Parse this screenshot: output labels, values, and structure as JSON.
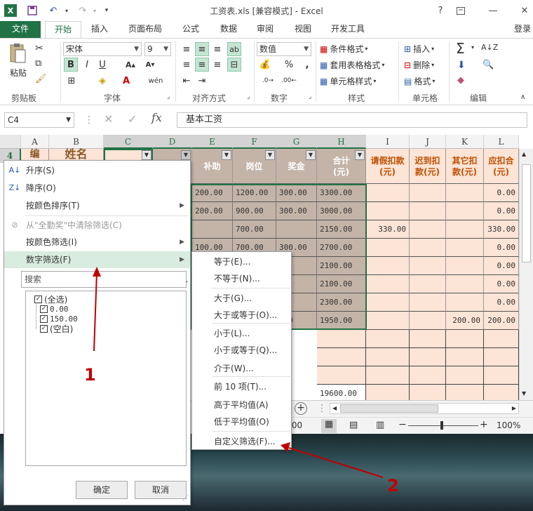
{
  "app": {
    "title": "工资表.xls  [兼容模式] - Excel",
    "account": "登录"
  },
  "quick_access": {
    "excel_logo": "X",
    "help": "?",
    "minimize": "—",
    "close": "✕"
  },
  "ribbon_tabs": [
    "文件",
    "开始",
    "插入",
    "页面布局",
    "公式",
    "数据",
    "审阅",
    "视图",
    "开发工具"
  ],
  "ribbon": {
    "clipboard": {
      "paste": "粘贴",
      "label": "剪贴板"
    },
    "font": {
      "name": "宋体",
      "size": "9",
      "bold": "B",
      "italic": "I",
      "underline": "U",
      "wen": "wén",
      "label": "字体"
    },
    "align": {
      "label": "对齐方式"
    },
    "number": {
      "format": "数值",
      "label": "数字",
      "pct": "%",
      "comma": ","
    },
    "styles": {
      "cond": "条件格式",
      "table": "套用表格格式",
      "cell": "单元格样式",
      "label": "样式"
    },
    "cells": {
      "insert": "插入",
      "delete": "删除",
      "format": "格式",
      "label": "单元格"
    },
    "edit": {
      "label": "编辑"
    }
  },
  "formula_bar": {
    "name_box": "C4",
    "formula": "基本工资",
    "fx": "fx"
  },
  "grid": {
    "columns": [
      "A",
      "B",
      "C",
      "D",
      "E",
      "F",
      "G",
      "H",
      "I",
      "J",
      "K",
      "L"
    ],
    "row_number": "4",
    "header_cells": {
      "A": "编",
      "B": "姓名",
      "E": "补助",
      "F": "岗位",
      "G": "奖金",
      "H": "合计\n(元)",
      "I": "请假扣款\n(元)",
      "J": "迟到扣\n款(元)",
      "K": "其它扣\n款(元)",
      "L": "应扣合\n(元)"
    },
    "rows": [
      {
        "E": "200.00",
        "F": "1200.00",
        "G": "300.00",
        "H": "3300.00",
        "I": "",
        "J": "",
        "K": "",
        "L": "0.00"
      },
      {
        "E": "200.00",
        "F": "900.00",
        "G": "300.00",
        "H": "3000.00",
        "I": "",
        "J": "",
        "K": "",
        "L": "0.00"
      },
      {
        "E": "",
        "F": "700.00",
        "G": "",
        "H": "2150.00",
        "I": "330.00",
        "J": "",
        "K": "",
        "L": "330.00"
      },
      {
        "E": "100.00",
        "F": "700.00",
        "G": "300.00",
        "H": "2700.00",
        "I": "",
        "J": "",
        "K": "",
        "L": "0.00"
      },
      {
        "E": "",
        "F": "",
        "G": "",
        "H": "2100.00",
        "I": "",
        "J": "",
        "K": "",
        "L": "0.00"
      },
      {
        "E": "",
        "F": "",
        "G": "",
        "H": "2100.00",
        "I": "",
        "J": "",
        "K": "",
        "L": "0.00"
      },
      {
        "E": "",
        "F": "",
        "G": "",
        "H": "2300.00",
        "I": "",
        "J": "",
        "K": "",
        "L": "0.00"
      },
      {
        "E": "",
        "F": "",
        "G": ".00",
        "H": "1950.00",
        "I": "",
        "J": "",
        "K": "200.00",
        "L": "200.00"
      }
    ],
    "total": "19600.00"
  },
  "filter_menu": {
    "items": [
      "升序(S)",
      "降序(O)",
      "按颜色排序(T)",
      "从\"全勤奖\"中清除筛选(C)",
      "按颜色筛选(I)",
      "数字筛选(F)"
    ],
    "search_placeholder": "搜索",
    "checklist": [
      "(全选)",
      "0.00",
      "150.00",
      "(空白)"
    ],
    "ok": "确定",
    "cancel": "取消"
  },
  "number_filter_submenu": [
    "等于(E)...",
    "不等于(N)...",
    "大于(G)...",
    "大于或等于(O)...",
    "小于(L)...",
    "小于或等于(Q)...",
    "介于(W)...",
    "前 10 项(T)...",
    "高于平均值(A)",
    "低于平均值(O)",
    "自定义筛选(F)..."
  ],
  "status": {
    "zoom": "100%",
    "partial": ".00"
  },
  "annotations": {
    "one": "1",
    "two": "2"
  },
  "colors": {
    "accent": "#217346",
    "header_fill": "#fce4d6",
    "selected_fill": "#c4b4a8",
    "annotation": "#c00000"
  }
}
